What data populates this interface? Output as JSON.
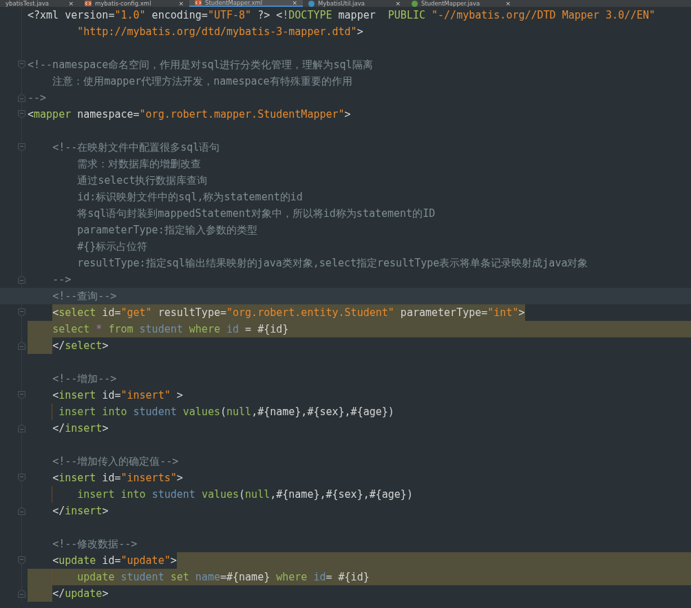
{
  "tabs": [
    {
      "label": "ybatisTest.java",
      "kind": "plain",
      "close": "×",
      "selected": false
    },
    {
      "label": "mybatis-config.xml",
      "kind": "xml",
      "close": "×",
      "selected": false
    },
    {
      "label": "StudentMapper.xml",
      "kind": "xml",
      "close": "×",
      "selected": true
    },
    {
      "label": "MybatisUtil.java",
      "kind": "class",
      "close": "×",
      "selected": false
    },
    {
      "label": "StudentMapper.java",
      "kind": "interface",
      "close": "×",
      "selected": false
    }
  ],
  "editor": {
    "lines": [
      {
        "tokens": [
          {
            "text": "<?xml version=",
            "kind": "plain"
          },
          {
            "text": "\"1.0\"",
            "kind": "string"
          },
          {
            "text": " encoding=",
            "kind": "plain"
          },
          {
            "text": "\"UTF-8\"",
            "kind": "string"
          },
          {
            "text": " ?> <",
            "kind": "plain"
          },
          {
            "text": "!DOCTYPE",
            "kind": "tag"
          },
          {
            "text": " mapper  ",
            "kind": "plain"
          },
          {
            "text": "PUBLIC",
            "kind": "tag"
          },
          {
            "text": " \"-//mybatis.org//DTD Mapper 3.0//EN\"",
            "kind": "string"
          }
        ]
      },
      {
        "tokens": [
          {
            "text": "        \"http://mybatis.org/dtd/mybatis-3-mapper.dtd\"",
            "kind": "string"
          },
          {
            "text": ">",
            "kind": "plain"
          }
        ]
      },
      {
        "kind": "blank"
      },
      {
        "fold_start": true,
        "tokens": [
          {
            "text": "<!--namespace命名空间，作用是对sql进行分类化管理，理解为sql隔离",
            "kind": "comment"
          }
        ]
      },
      {
        "tokens": [
          {
            "text": "    注意：使用mapper代理方法开发，namespace有特殊重要的作用",
            "kind": "comment"
          }
        ]
      },
      {
        "fold_end": true,
        "tokens": [
          {
            "text": "-->",
            "kind": "comment"
          }
        ]
      },
      {
        "fold_start": true,
        "tokens": [
          {
            "text": "<",
            "kind": "plain"
          },
          {
            "text": "mapper",
            "kind": "tag"
          },
          {
            "text": " namespace=",
            "kind": "plain"
          },
          {
            "text": "\"org.robert.mapper.StudentMapper\"",
            "kind": "string"
          },
          {
            "text": ">",
            "kind": "plain"
          }
        ]
      },
      {
        "kind": "blank"
      },
      {
        "fold_start": true,
        "tokens": [
          {
            "text": "    <!--在映射文件中配置很多sql语句",
            "kind": "comment"
          }
        ]
      },
      {
        "tokens": [
          {
            "text": "        需求：对数据库的增删改查",
            "kind": "comment"
          }
        ]
      },
      {
        "tokens": [
          {
            "text": "        通过select执行数据库查询",
            "kind": "comment"
          }
        ]
      },
      {
        "tokens": [
          {
            "text": "        id:标识映射文件中的sql,称为statement的id",
            "kind": "comment"
          }
        ]
      },
      {
        "tokens": [
          {
            "text": "        将sql语句封装到mappedStatement对象中，所以将id称为statement的ID",
            "kind": "comment"
          }
        ]
      },
      {
        "tokens": [
          {
            "text": "        parameterType:指定输入参数的类型",
            "kind": "comment"
          }
        ]
      },
      {
        "tokens": [
          {
            "text": "        #{}标示占位符",
            "kind": "comment"
          }
        ]
      },
      {
        "tokens": [
          {
            "text": "        resultType:指定sql输出结果映射的java类对象,select指定resultType表示将单条记录映射成java对象",
            "kind": "comment"
          }
        ]
      },
      {
        "fold_end": true,
        "tokens": [
          {
            "text": "    -->",
            "kind": "comment"
          }
        ]
      },
      {
        "current": true,
        "tokens": [
          {
            "text": "    <!--查询-->",
            "kind": "comment"
          }
        ]
      },
      {
        "fold_start": true,
        "kind": "selected_text",
        "tokens": [
          {
            "text": "    <",
            "kind": "plain"
          },
          {
            "text": "select",
            "kind": "tag"
          },
          {
            "text": " id=",
            "kind": "plain"
          },
          {
            "text": "\"get\"",
            "kind": "string"
          },
          {
            "text": " resultType=",
            "kind": "plain"
          },
          {
            "text": "\"org.robert.entity.Student\"",
            "kind": "string"
          },
          {
            "text": " parameterType=",
            "kind": "plain"
          },
          {
            "text": "\"int\"",
            "kind": "string"
          },
          {
            "text": ">",
            "kind": "plain"
          }
        ]
      },
      {
        "kind": "selected_full",
        "tokens": [
          {
            "text": "    select ",
            "kind": "keyword"
          },
          {
            "text": "* ",
            "kind": "operator"
          },
          {
            "text": "from ",
            "kind": "keyword"
          },
          {
            "text": "student ",
            "kind": "ident"
          },
          {
            "text": "where ",
            "kind": "keyword"
          },
          {
            "text": "id ",
            "kind": "ident"
          },
          {
            "text": "= #{id}",
            "kind": "plain"
          }
        ]
      },
      {
        "fold_end": true,
        "kind": "selected_indent",
        "tokens": [
          {
            "text": "    </",
            "kind": "plain"
          },
          {
            "text": "select",
            "kind": "tag"
          },
          {
            "text": ">",
            "kind": "plain"
          }
        ]
      },
      {
        "kind": "blank"
      },
      {
        "tokens": [
          {
            "text": "    <!--增加-->",
            "kind": "comment"
          }
        ]
      },
      {
        "fold_start": true,
        "tokens": [
          {
            "text": "    <",
            "kind": "plain"
          },
          {
            "text": "insert",
            "kind": "tag"
          },
          {
            "text": " id=",
            "kind": "plain"
          },
          {
            "text": "\"insert\"",
            "kind": "string"
          },
          {
            "text": " >",
            "kind": "plain"
          }
        ]
      },
      {
        "guide": true,
        "tokens": [
          {
            "text": "     insert into ",
            "kind": "keyword"
          },
          {
            "text": "student ",
            "kind": "ident"
          },
          {
            "text": "values",
            "kind": "keyword"
          },
          {
            "text": "(",
            "kind": "plain"
          },
          {
            "text": "null",
            "kind": "keyword"
          },
          {
            "text": ",#{name},#{sex},#{age})",
            "kind": "plain"
          }
        ]
      },
      {
        "fold_end": true,
        "tokens": [
          {
            "text": "    </",
            "kind": "plain"
          },
          {
            "text": "insert",
            "kind": "tag"
          },
          {
            "text": ">",
            "kind": "plain"
          }
        ]
      },
      {
        "kind": "blank"
      },
      {
        "tokens": [
          {
            "text": "    <!--增加传入的确定值-->",
            "kind": "comment"
          }
        ]
      },
      {
        "fold_start": true,
        "tokens": [
          {
            "text": "    <",
            "kind": "plain"
          },
          {
            "text": "insert",
            "kind": "tag"
          },
          {
            "text": " id=",
            "kind": "plain"
          },
          {
            "text": "\"inserts\"",
            "kind": "string"
          },
          {
            "text": ">",
            "kind": "plain"
          }
        ]
      },
      {
        "guide": true,
        "tokens": [
          {
            "text": "        insert into ",
            "kind": "keyword"
          },
          {
            "text": "student ",
            "kind": "ident"
          },
          {
            "text": "values",
            "kind": "keyword"
          },
          {
            "text": "(",
            "kind": "plain"
          },
          {
            "text": "null",
            "kind": "keyword"
          },
          {
            "text": ",#{name},#{sex},#{age})",
            "kind": "plain"
          }
        ]
      },
      {
        "fold_end": true,
        "tokens": [
          {
            "text": "    </",
            "kind": "plain"
          },
          {
            "text": "insert",
            "kind": "tag"
          },
          {
            "text": ">",
            "kind": "plain"
          }
        ]
      },
      {
        "kind": "blank"
      },
      {
        "tokens": [
          {
            "text": "    <!--修改数据-->",
            "kind": "comment"
          }
        ]
      },
      {
        "fold_start": true,
        "kind": "selected_after",
        "tokens": [
          {
            "text": "    <",
            "kind": "plain"
          },
          {
            "text": "update",
            "kind": "tag"
          },
          {
            "text": " id=",
            "kind": "plain"
          },
          {
            "text": "\"update\"",
            "kind": "string"
          },
          {
            "text": ">",
            "kind": "plain"
          }
        ]
      },
      {
        "guide": true,
        "kind": "selected_full",
        "tokens": [
          {
            "text": "        update ",
            "kind": "keyword"
          },
          {
            "text": "student ",
            "kind": "ident"
          },
          {
            "text": "set ",
            "kind": "keyword"
          },
          {
            "text": "name",
            "kind": "ident"
          },
          {
            "text": "=#{name} ",
            "kind": "plain"
          },
          {
            "text": "where ",
            "kind": "keyword"
          },
          {
            "text": "id",
            "kind": "ident"
          },
          {
            "text": "= #{id}",
            "kind": "plain"
          }
        ]
      },
      {
        "fold_end": true,
        "kind": "selected_indent",
        "tokens": [
          {
            "text": "    </",
            "kind": "plain"
          },
          {
            "text": "update",
            "kind": "tag"
          },
          {
            "text": ">",
            "kind": "plain"
          }
        ]
      }
    ]
  }
}
